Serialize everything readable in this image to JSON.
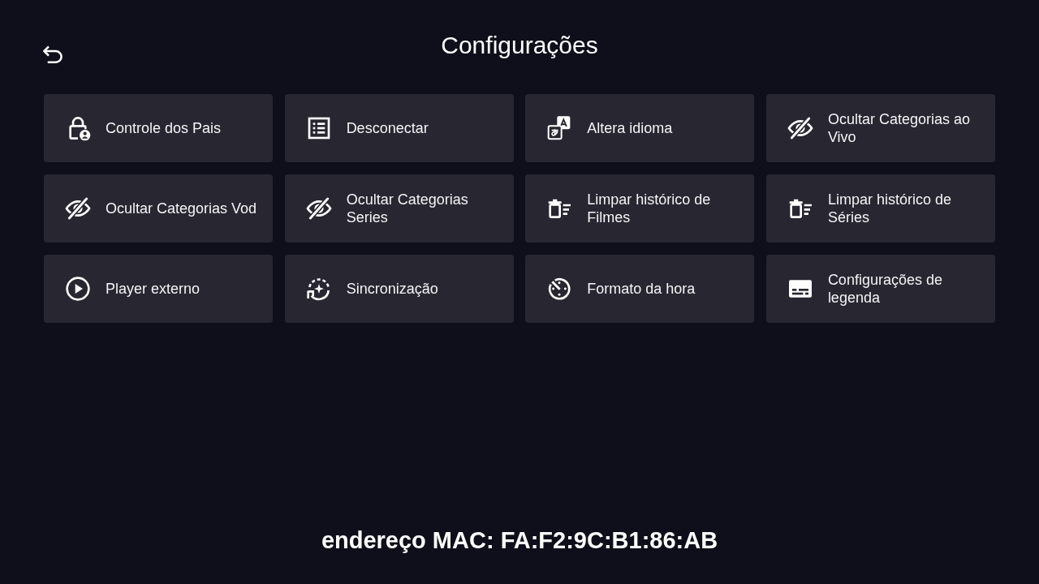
{
  "header": {
    "title": "Configurações"
  },
  "settings": [
    {
      "label": "Controle dos Pais",
      "kind": "parental"
    },
    {
      "label": "Desconectar",
      "kind": "list"
    },
    {
      "label": "Altera idioma",
      "kind": "language"
    },
    {
      "label": "Ocultar Categorias ao Vivo",
      "kind": "hide"
    },
    {
      "label": "Ocultar Categorias Vod",
      "kind": "hide"
    },
    {
      "label": "Ocultar Categorias Series",
      "kind": "hide"
    },
    {
      "label": "Limpar histórico de Filmes",
      "kind": "clear"
    },
    {
      "label": "Limpar histórico de Séries",
      "kind": "clear"
    },
    {
      "label": "Player externo",
      "kind": "player"
    },
    {
      "label": "Sincronização",
      "kind": "sync"
    },
    {
      "label": "Formato da hora",
      "kind": "time"
    },
    {
      "label": "Configurações de legenda",
      "kind": "subtitles"
    }
  ],
  "footer": {
    "mac_address": "endereço MAC: FA:F2:9C:B1:86:AB"
  }
}
